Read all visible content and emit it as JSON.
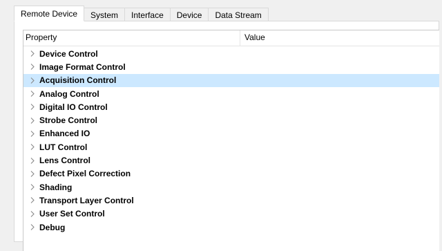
{
  "tabs": [
    {
      "label": "Remote Device",
      "active": true
    },
    {
      "label": "System",
      "active": false
    },
    {
      "label": "Interface",
      "active": false
    },
    {
      "label": "Device",
      "active": false
    },
    {
      "label": "Data Stream",
      "active": false
    }
  ],
  "grid": {
    "columns": {
      "property": "Property",
      "value": "Value"
    },
    "rows": [
      {
        "label": "Device Control",
        "selected": false
      },
      {
        "label": "Image Format Control",
        "selected": false
      },
      {
        "label": "Acquisition Control",
        "selected": true
      },
      {
        "label": "Analog Control",
        "selected": false
      },
      {
        "label": "Digital IO Control",
        "selected": false
      },
      {
        "label": "Strobe Control",
        "selected": false
      },
      {
        "label": "Enhanced IO",
        "selected": false
      },
      {
        "label": "LUT Control",
        "selected": false
      },
      {
        "label": "Lens Control",
        "selected": false
      },
      {
        "label": "Defect Pixel Correction",
        "selected": false
      },
      {
        "label": "Shading",
        "selected": false
      },
      {
        "label": "Transport Layer Control",
        "selected": false
      },
      {
        "label": "User Set Control",
        "selected": false
      },
      {
        "label": "Debug",
        "selected": false
      }
    ]
  },
  "icons": {
    "expander": "chevron-right-icon"
  },
  "colors": {
    "selection": "#cce8ff",
    "chevron": "#8a8a8a"
  }
}
